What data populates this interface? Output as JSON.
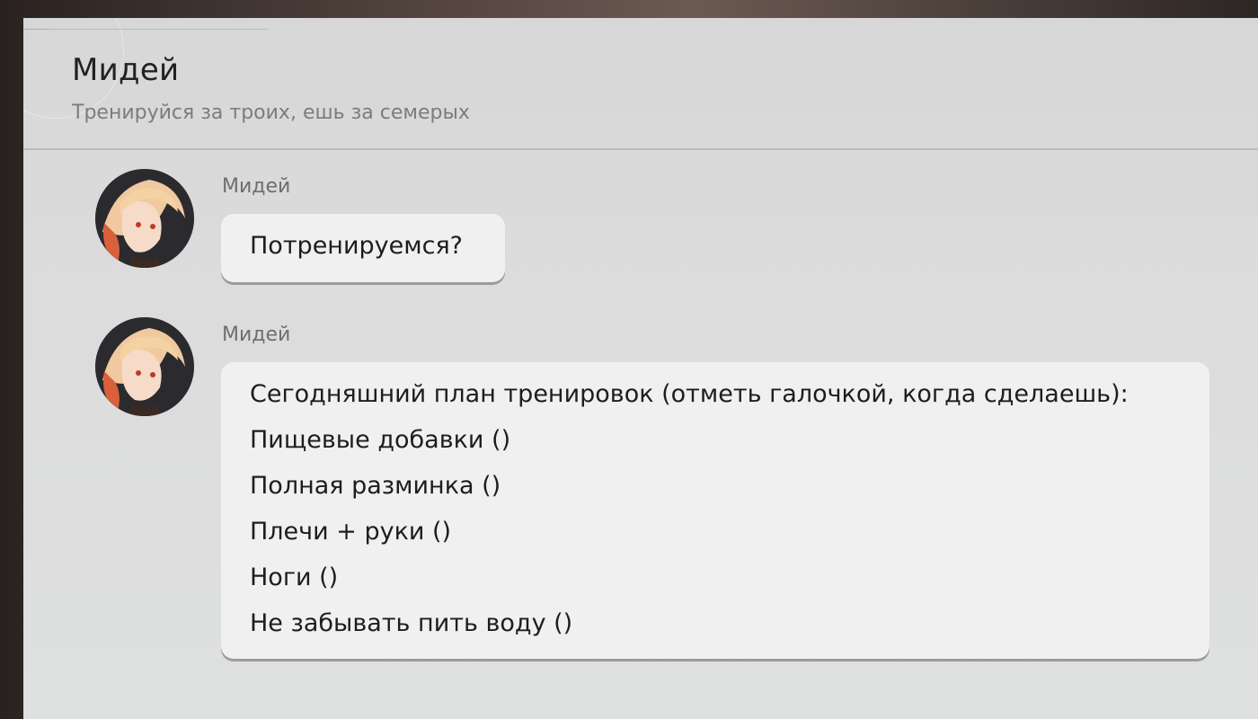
{
  "chat": {
    "title": "Мидей",
    "subtitle": "Тренируйся за троих, ешь за семерых"
  },
  "messages": [
    {
      "sender": "Мидей",
      "avatar_icon": "character-portrait-icon",
      "lines": [
        "Потренируемся?"
      ]
    },
    {
      "sender": "Мидей",
      "avatar_icon": "character-portrait-icon",
      "lines": [
        "Сегодняшний план тренировок (отметь галочкой, когда сделаешь):",
        "Пищевые добавки ()",
        "Полная разминка ()",
        "Плечи + руки ()",
        "Ноги ()",
        "Не забывать пить воду ()"
      ]
    }
  ],
  "colors": {
    "panel": "#dcdcdc",
    "bubble": "#f0f0f0",
    "title": "#222222",
    "subtitle": "#7c7c7c"
  }
}
